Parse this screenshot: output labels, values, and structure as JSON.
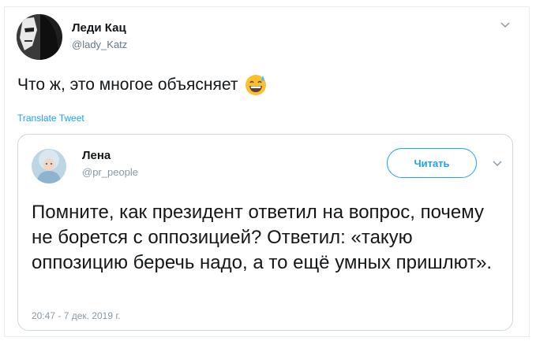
{
  "tweet": {
    "author": {
      "name": "Леди Кац",
      "handle": "@lady_Katz"
    },
    "text": "Что ж, это многое объясняет",
    "emoji": "grinning-face-with-sweat",
    "translate_label": "Translate Tweet"
  },
  "quoted_tweet": {
    "author": {
      "name": "Лена",
      "handle": "@pr_people"
    },
    "follow_label": "Читать",
    "text": "Помните, как президент ответил на вопрос, почему не борется с оппозицией? Ответил: «такую оппозицию беречь надо, а то ещё умных пришлют».",
    "timestamp": "20:47 - 7 дек. 2019 г."
  },
  "colors": {
    "accent": "#1da1f2",
    "text": "#14171a",
    "muted": "#657786",
    "border": "#ccd6dd"
  }
}
